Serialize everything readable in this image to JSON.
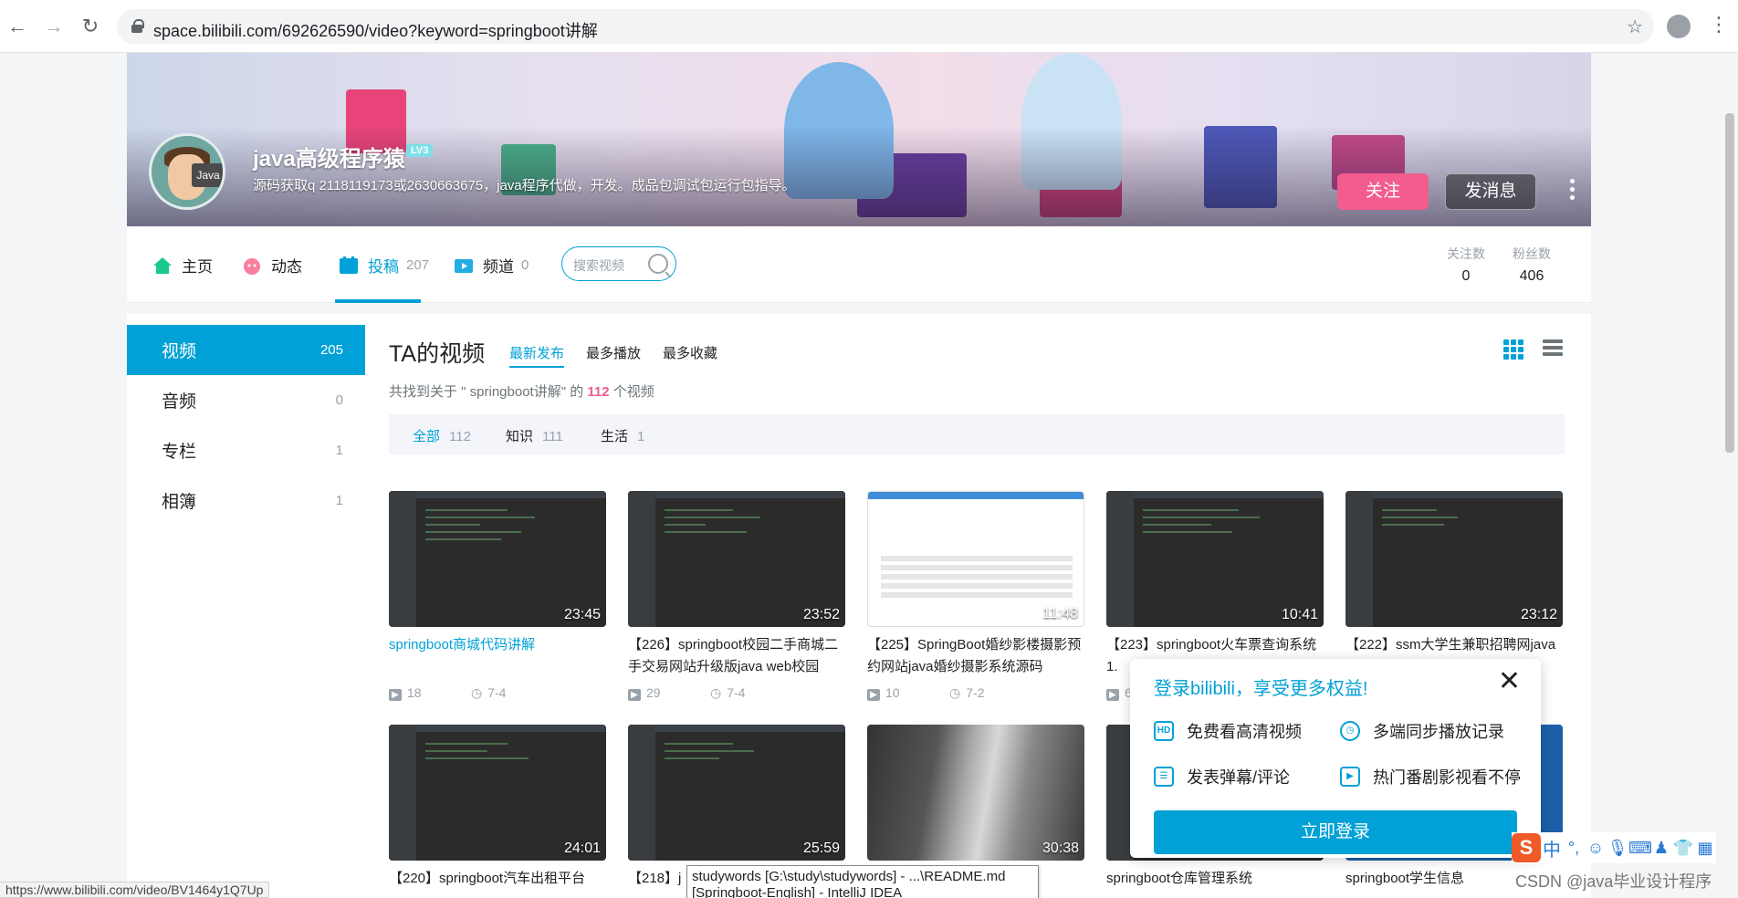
{
  "browser": {
    "url": "space.bilibili.com/692626590/video?keyword=springboot讲解"
  },
  "banner": {
    "up_name": "java高级程序猿",
    "level": "LV3",
    "avatar_text": "Java",
    "sign": "源码获取q 2118119173或2630663675，java程序代做，开发。成品包调试包运行包指导。",
    "follow_label": "关注",
    "message_label": "发消息"
  },
  "nav": {
    "items": [
      {
        "label": "主页",
        "count": ""
      },
      {
        "label": "动态",
        "count": ""
      },
      {
        "label": "投稿",
        "count": "207"
      },
      {
        "label": "频道",
        "count": "0"
      }
    ],
    "search_placeholder": "搜索视频",
    "following_label": "关注数",
    "following_value": "0",
    "fans_label": "粉丝数",
    "fans_value": "406"
  },
  "sidebar": {
    "items": [
      {
        "label": "视频",
        "count": "205"
      },
      {
        "label": "音频",
        "count": "0"
      },
      {
        "label": "专栏",
        "count": "1"
      },
      {
        "label": "相簿",
        "count": "1"
      }
    ]
  },
  "main": {
    "title": "TA的视频",
    "sorts": [
      "最新发布",
      "最多播放",
      "最多收藏"
    ],
    "found_prefix": "共找到关于 \" springboot讲解\" 的",
    "found_count": "112",
    "found_suffix": "个视频",
    "filters": [
      {
        "label": "全部",
        "count": "112"
      },
      {
        "label": "知识",
        "count": "111"
      },
      {
        "label": "生活",
        "count": "1"
      }
    ]
  },
  "videos": [
    {
      "title": "springboot商城代码讲解",
      "duration": "23:45",
      "plays": "18",
      "date": "7-4"
    },
    {
      "title": "【226】springboot校园二手商城二手交易网站升级版java web校园",
      "duration": "23:52",
      "plays": "29",
      "date": "7-4"
    },
    {
      "title": "【225】SpringBoot婚纱影楼摄影预约网站java婚纱摄影系统源码",
      "duration": "11:48",
      "plays": "10",
      "date": "7-2"
    },
    {
      "title": "【223】springboot火车票查询系统1.",
      "duration": "10:41",
      "plays": "6",
      "date": ""
    },
    {
      "title": "【222】ssm大学生兼职招聘网java",
      "duration": "23:12",
      "plays": "",
      "date": ""
    },
    {
      "title": "【220】springboot汽车出租平台",
      "duration": "24:01",
      "plays": "",
      "date": ""
    },
    {
      "title": "【218】j",
      "duration": "25:59",
      "plays": "",
      "date": ""
    },
    {
      "title": "",
      "duration": "30:38",
      "plays": "",
      "date": ""
    },
    {
      "title": "springboot仓库管理系统",
      "duration": "",
      "plays": "",
      "date": ""
    },
    {
      "title": "springboot学生信息",
      "duration": "",
      "plays": "",
      "date": ""
    }
  ],
  "popup": {
    "title": "登录bilibili，享受更多权益!",
    "features": [
      "免费看高清视频",
      "多端同步播放记录",
      "发表弹幕/评论",
      "热门番剧影视看不停"
    ],
    "login_label": "立即登录"
  },
  "tooltip": {
    "line1": "studywords [G:\\study\\studywords] - ...\\README.md",
    "line2": "[Springboot-English] - IntelliJ IDEA"
  },
  "status_url": "https://www.bilibili.com/video/BV1464y1Q7Up",
  "ime": {
    "logo": "S",
    "lang": "中"
  },
  "watermark": "CSDN @java毕业设计程序"
}
